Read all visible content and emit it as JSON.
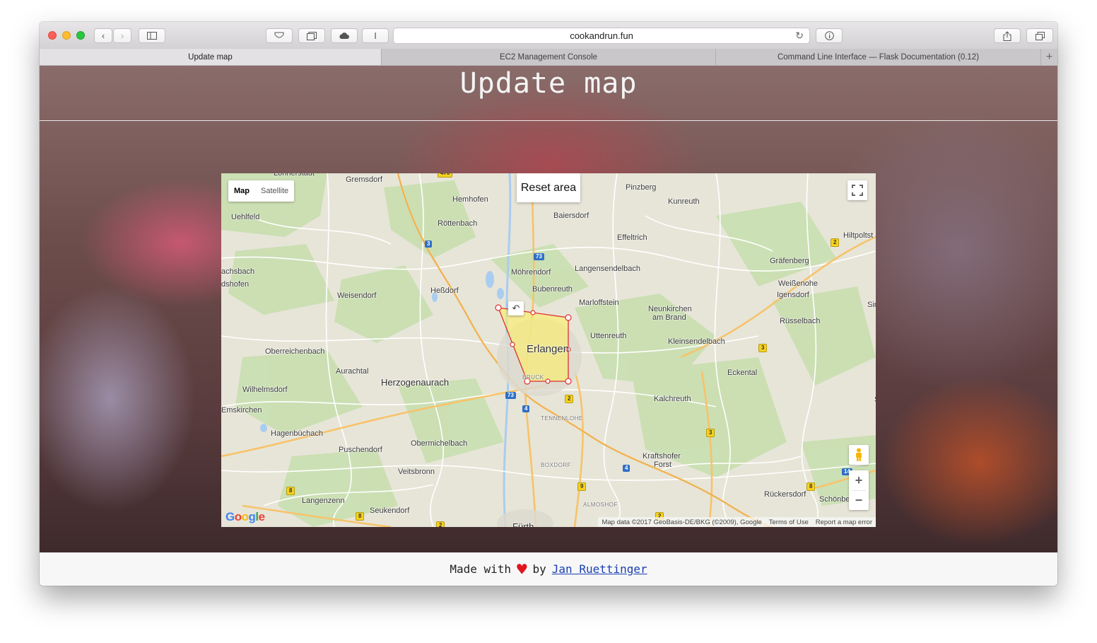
{
  "browser": {
    "url": "cookandrun.fun",
    "tabs": [
      {
        "label": "Update map",
        "active": true
      },
      {
        "label": "EC2 Management Console",
        "active": false
      },
      {
        "label": "Command Line Interface — Flask Documentation (0.12)",
        "active": false
      }
    ],
    "new_tab_symbol": "+",
    "reader_symbol": "I"
  },
  "page": {
    "title": "Update map"
  },
  "map": {
    "type_options": [
      "Map",
      "Satellite"
    ],
    "selected_type": "Map",
    "reset_button": "Reset area",
    "zoom_in": "+",
    "zoom_out": "−",
    "google_logo": "Google",
    "attribution": {
      "data": "Map data ©2017 GeoBasis-DE/BKG (©2009), Google",
      "terms": "Terms of Use",
      "report": "Report a map error"
    },
    "places": [
      {
        "name": "Gremsdorf",
        "cls": ""
      },
      {
        "name": "Hemhofen",
        "cls": ""
      },
      {
        "name": "Pinzberg",
        "cls": ""
      },
      {
        "name": "Kunreuth",
        "cls": ""
      },
      {
        "name": "Uehlfeld",
        "cls": ""
      },
      {
        "name": "Röttenbach",
        "cls": ""
      },
      {
        "name": "Baiersdorf",
        "cls": ""
      },
      {
        "name": "Effeltrich",
        "cls": ""
      },
      {
        "name": "Hiltpoltst",
        "cls": ""
      },
      {
        "name": "Möhrendorf",
        "cls": ""
      },
      {
        "name": "Langensendelbach",
        "cls": ""
      },
      {
        "name": "Gräfenberg",
        "cls": ""
      },
      {
        "name": "achsbach",
        "cls": ""
      },
      {
        "name": "dshofen",
        "cls": ""
      },
      {
        "name": "Heßdorf",
        "cls": ""
      },
      {
        "name": "Bubenreuth",
        "cls": ""
      },
      {
        "name": "Weißenohe",
        "cls": ""
      },
      {
        "name": "Weisendorf",
        "cls": ""
      },
      {
        "name": "Marloffstein",
        "cls": ""
      },
      {
        "name": "Igensdorf",
        "cls": ""
      },
      {
        "name": "Neunkirchen",
        "cls": ""
      },
      {
        "name": "am Brand",
        "cls": ""
      },
      {
        "name": "Simm",
        "cls": ""
      },
      {
        "name": "Rüsselbach",
        "cls": ""
      },
      {
        "name": "Uttenreuth",
        "cls": ""
      },
      {
        "name": "Erlangen",
        "cls": "city"
      },
      {
        "name": "Oberreichenbach",
        "cls": ""
      },
      {
        "name": "Kleinsendelbach",
        "cls": ""
      },
      {
        "name": "Aurachtal",
        "cls": ""
      },
      {
        "name": "Eckental",
        "cls": ""
      },
      {
        "name": "Herzogenaurach",
        "cls": "big"
      },
      {
        "name": "Wilhelmsdorf",
        "cls": ""
      },
      {
        "name": "BRUCK",
        "cls": "small"
      },
      {
        "name": "Kalchreuth",
        "cls": ""
      },
      {
        "name": "Sch",
        "cls": ""
      },
      {
        "name": "Emskirchen",
        "cls": ""
      },
      {
        "name": "TENNENLOHE",
        "cls": "small"
      },
      {
        "name": "Hagenbüchach",
        "cls": ""
      },
      {
        "name": "Obermichelbach",
        "cls": ""
      },
      {
        "name": "Puschendorf",
        "cls": ""
      },
      {
        "name": "Kraftshofer",
        "cls": ""
      },
      {
        "name": "Forst",
        "cls": ""
      },
      {
        "name": "N",
        "cls": ""
      },
      {
        "name": "Veitsbronn",
        "cls": ""
      },
      {
        "name": "BOXDORF",
        "cls": "small"
      },
      {
        "name": "Rückersdorf",
        "cls": ""
      },
      {
        "name": "Schönbe",
        "cls": ""
      },
      {
        "name": "Langenzenn",
        "cls": ""
      },
      {
        "name": "ALMOSHOF",
        "cls": "small"
      },
      {
        "name": "Seukendorf",
        "cls": ""
      },
      {
        "name": "Fürth",
        "cls": "big"
      },
      {
        "name": "Lonnerstadt",
        "cls": ""
      }
    ],
    "shields": [
      "470",
      "3",
      "73",
      "2",
      "3",
      "73",
      "4",
      "2",
      "3",
      "4",
      "9",
      "14",
      "8",
      "8",
      "8",
      "2",
      "2"
    ]
  },
  "footer": {
    "made_with": "Made with",
    "heart": "♥",
    "by": "by",
    "author": "Jan Ruettinger"
  }
}
